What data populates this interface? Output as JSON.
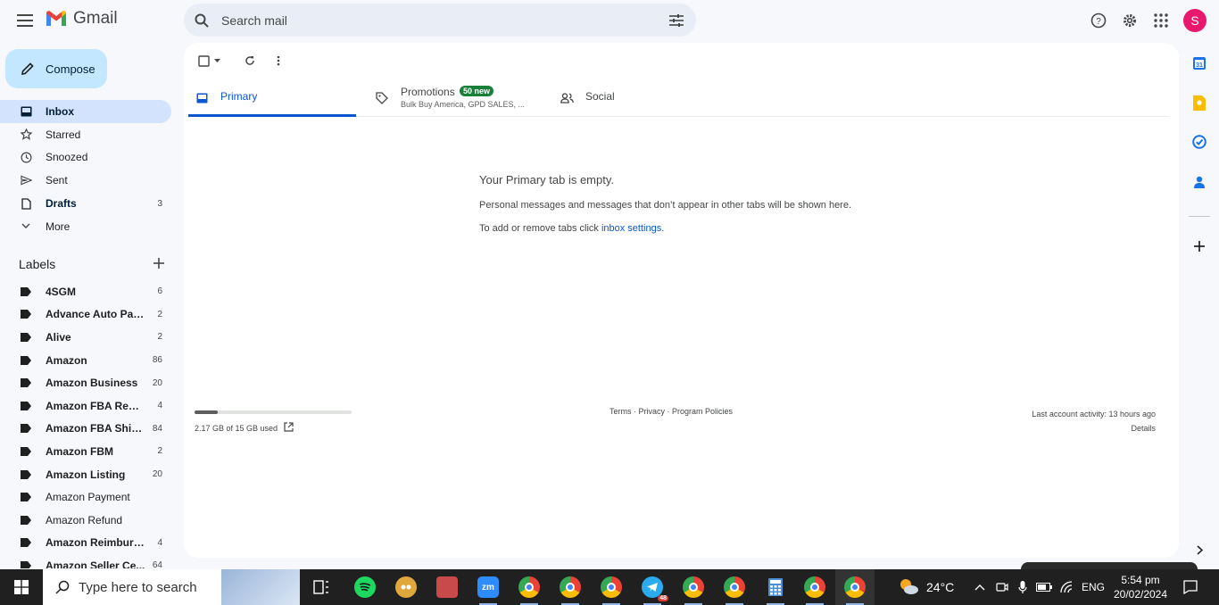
{
  "app": {
    "name": "Gmail"
  },
  "search": {
    "placeholder": "Search mail"
  },
  "user": {
    "initial": "S",
    "avatar_color": "#e8186e"
  },
  "compose": {
    "label": "Compose"
  },
  "nav": [
    {
      "label": "Inbox",
      "count": "",
      "icon": "inbox-icon",
      "active": true
    },
    {
      "label": "Starred",
      "count": "",
      "icon": "star-icon"
    },
    {
      "label": "Snoozed",
      "count": "",
      "icon": "clock-icon"
    },
    {
      "label": "Sent",
      "count": "",
      "icon": "send-icon"
    },
    {
      "label": "Drafts",
      "count": "3",
      "icon": "draft-icon",
      "bold": true
    },
    {
      "label": "More",
      "count": "",
      "icon": "chevron-down-icon"
    }
  ],
  "labels_section": {
    "title": "Labels"
  },
  "labels": [
    {
      "label": "4SGM",
      "count": "6",
      "bold": true
    },
    {
      "label": "Advance Auto Parts",
      "count": "2",
      "bold": true
    },
    {
      "label": "Alive",
      "count": "2",
      "bold": true
    },
    {
      "label": "Amazon",
      "count": "86",
      "bold": true
    },
    {
      "label": "Amazon Business",
      "count": "20",
      "bold": true
    },
    {
      "label": "Amazon FBA Remo...",
      "count": "4",
      "bold": true
    },
    {
      "label": "Amazon FBA Ship...",
      "count": "84",
      "bold": true
    },
    {
      "label": "Amazon FBM",
      "count": "2",
      "bold": true
    },
    {
      "label": "Amazon Listing",
      "count": "20",
      "bold": true
    },
    {
      "label": "Amazon Payment",
      "count": "",
      "bold": false
    },
    {
      "label": "Amazon Refund",
      "count": "",
      "bold": false
    },
    {
      "label": "Amazon Reimburs...",
      "count": "4",
      "bold": true
    },
    {
      "label": "Amazon Seller Ce...",
      "count": "64",
      "bold": true
    }
  ],
  "tabs": {
    "primary": {
      "label": "Primary"
    },
    "promotions": {
      "label": "Promotions",
      "badge": "50 new",
      "subtitle": "Bulk Buy America, GPD SALES, ..."
    },
    "social": {
      "label": "Social"
    }
  },
  "empty_state": {
    "title": "Your Primary tab is empty.",
    "body": "Personal messages and messages that don’t appear in other tabs will be shown here.",
    "settings_prefix": "To add or remove tabs click ",
    "settings_link": "inbox settings",
    "settings_suffix": "."
  },
  "storage": {
    "text": "2.17 GB of 15 GB used",
    "used_fraction": 0.145
  },
  "footer": {
    "terms": "Terms",
    "sep1": " · ",
    "privacy": "Privacy",
    "sep2": " · ",
    "policies": "Program Policies"
  },
  "activity": {
    "text": "Last account activity: 13 hours ago",
    "details": "Details"
  },
  "taskbar": {
    "search_placeholder": "Type here to search",
    "weather": "24°C",
    "lang": "ENG",
    "time": "5:54 pm",
    "date": "20/02/2024",
    "telegram_badge": "48"
  },
  "colors": {
    "accent": "#0b57d0",
    "compose_bg": "#c2e7ff",
    "active_nav": "#d3e3fd",
    "badge_green": "#188038"
  }
}
